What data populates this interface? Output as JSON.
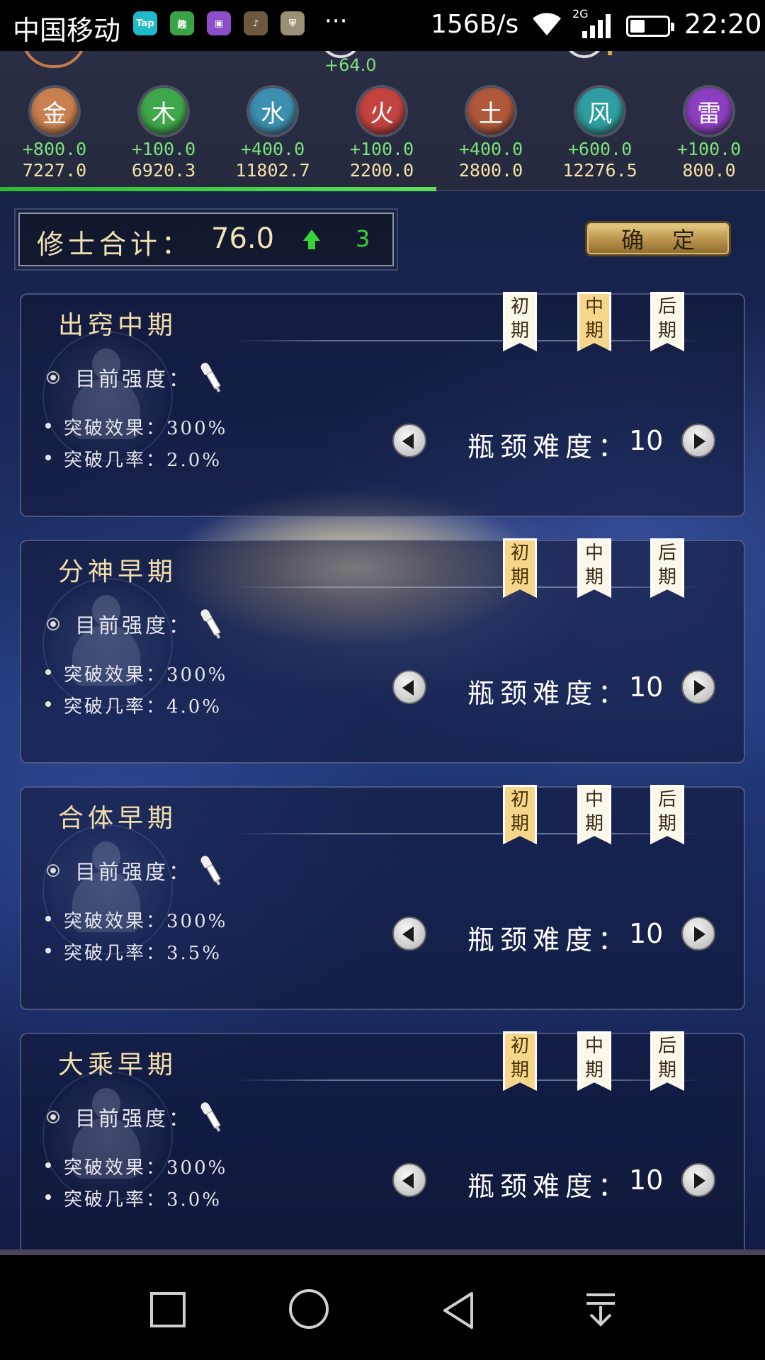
{
  "status_bar": {
    "carrier": "中国移动",
    "apps": [
      {
        "name": "taptap-app-icon",
        "label": "Tap",
        "color": "#1fb9c9"
      },
      {
        "name": "qu-app-icon",
        "label": "趣",
        "color": "#3aa34a"
      },
      {
        "name": "gallery-app-icon",
        "label": "▣",
        "color": "#8a4fc9"
      },
      {
        "name": "music-app-icon",
        "label": "♪",
        "color": "#6b5a3e"
      },
      {
        "name": "shield-app-icon",
        "label": "⛨",
        "color": "#9a9074"
      }
    ],
    "more": "···",
    "speed": "156B/s",
    "network": "2G",
    "battery_level": 0.4,
    "time": "22:20"
  },
  "top_remnant": {
    "gain": "+64.0"
  },
  "elements": [
    {
      "name": "金",
      "gain": "+800.0",
      "total": "7227.0",
      "color": "#c8804e"
    },
    {
      "name": "木",
      "gain": "+100.0",
      "total": "6920.3",
      "color": "#3fa84a"
    },
    {
      "name": "水",
      "gain": "+400.0",
      "total": "11802.7",
      "color": "#3d8fb0"
    },
    {
      "name": "火",
      "gain": "+100.0",
      "total": "2200.0",
      "color": "#c3433f"
    },
    {
      "name": "土",
      "gain": "+400.0",
      "total": "2800.0",
      "color": "#b0583a"
    },
    {
      "name": "风",
      "gain": "+600.0",
      "total": "12276.5",
      "color": "#2f9ea0"
    },
    {
      "name": "雷",
      "gain": "+100.0",
      "total": "800.0",
      "color": "#8c3fc0"
    }
  ],
  "progress": 0.57,
  "summary": {
    "label": "修士合计：",
    "value": "76.0",
    "count": "3"
  },
  "confirm_label": "确定",
  "cards": [
    {
      "title": "出窍中期",
      "strength_label": "目前强度：",
      "effect": "突破效果：300%",
      "rate": "突破几率：2.0%",
      "difficulty_label": "瓶颈难度：",
      "difficulty": "10",
      "phases": [
        "初期",
        "中期",
        "后期"
      ],
      "active_phase": 1
    },
    {
      "title": "分神早期",
      "strength_label": "目前强度：",
      "effect": "突破效果：300%",
      "rate": "突破几率：4.0%",
      "difficulty_label": "瓶颈难度：",
      "difficulty": "10",
      "phases": [
        "初期",
        "中期",
        "后期"
      ],
      "active_phase": 0
    },
    {
      "title": "合体早期",
      "strength_label": "目前强度：",
      "effect": "突破效果：300%",
      "rate": "突破几率：3.5%",
      "difficulty_label": "瓶颈难度：",
      "difficulty": "10",
      "phases": [
        "初期",
        "中期",
        "后期"
      ],
      "active_phase": 0
    },
    {
      "title": "大乘早期",
      "strength_label": "目前强度：",
      "effect": "突破效果：300%",
      "rate": "突破几率：3.0%",
      "difficulty_label": "瓶颈难度：",
      "difficulty": "10",
      "phases": [
        "初期",
        "中期",
        "后期"
      ],
      "active_phase": 0
    }
  ]
}
